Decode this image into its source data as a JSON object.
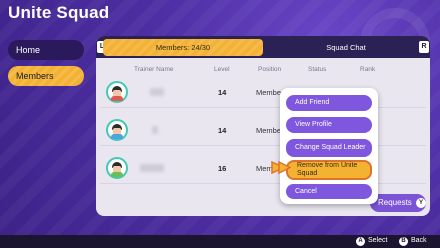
{
  "screen": {
    "title": "Unite Squad"
  },
  "sidebar": {
    "items": [
      {
        "label": "Home",
        "selected": false
      },
      {
        "label": "Members",
        "selected": true
      }
    ]
  },
  "tabs": {
    "left_bumper": "L",
    "right_bumper": "R",
    "members_label": "Members: 24/30",
    "chat_label": "Squad Chat"
  },
  "table": {
    "headers": [
      "Trainer Name",
      "Level",
      "Position",
      "Status",
      "Rank"
    ],
    "rows": [
      {
        "level": "14",
        "position": "Member"
      },
      {
        "level": "14",
        "position": "Member"
      },
      {
        "level": "16",
        "position": "Member"
      }
    ]
  },
  "context_menu": {
    "items": [
      {
        "label": "Add Friend",
        "selected": false
      },
      {
        "label": "View Profile",
        "selected": false
      },
      {
        "label": "Change Squad Leader",
        "selected": false
      },
      {
        "label": "Remove from Unite Squad",
        "selected": true
      },
      {
        "label": "Cancel",
        "selected": false
      }
    ]
  },
  "requests": {
    "label": "Requests",
    "button": "Y"
  },
  "footer": {
    "select_button": "A",
    "select_label": "Select",
    "back_button": "B",
    "back_label": "Back"
  },
  "colors": {
    "accent": "#f4b233",
    "menu_item": "#7f56de",
    "avatar_ring": "#42c9b4"
  }
}
